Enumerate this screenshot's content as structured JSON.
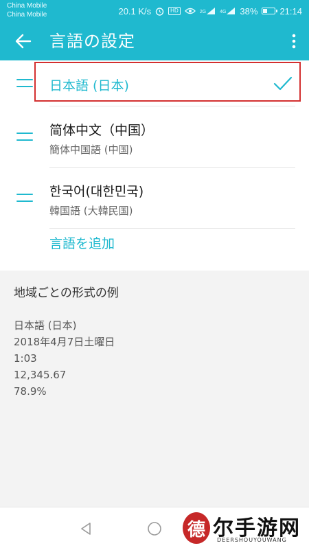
{
  "status_bar": {
    "carrier_1": "China Mobile",
    "carrier_2": "China Mobile",
    "speed": "20.1 K/s",
    "hd": "HD",
    "network": "2G",
    "network_2": "4G",
    "battery": "38%",
    "battery_level": 0.38,
    "time": "21:14"
  },
  "app_bar": {
    "title": "言語の設定",
    "back_icon": "back-arrow-icon",
    "more_icon": "more-vert-icon"
  },
  "languages": [
    {
      "primary": "日本語 (日本)",
      "secondary": "",
      "selected": true
    },
    {
      "primary": "简体中文（中国）",
      "secondary": "簡体中国語 (中国)",
      "selected": false
    },
    {
      "primary": "한국어(대한민국)",
      "secondary": "韓国語 (大韓民国)",
      "selected": false
    }
  ],
  "add_language": "言語を追加",
  "section": {
    "title": "地域ごとの形式の例",
    "examples": [
      "日本語 (日本)",
      "2018年4月7日土曜日",
      "1:03",
      "12,345.67",
      "78.9%"
    ]
  },
  "nav": {
    "back_icon": "nav-back-icon",
    "home_icon": "nav-home-icon"
  },
  "watermark": {
    "seal": "德",
    "text": "尔手游网",
    "url": "DEERSHOUYOUWANG"
  },
  "colors": {
    "accent": "#1fb9cf",
    "highlight": "#d32f2f"
  }
}
